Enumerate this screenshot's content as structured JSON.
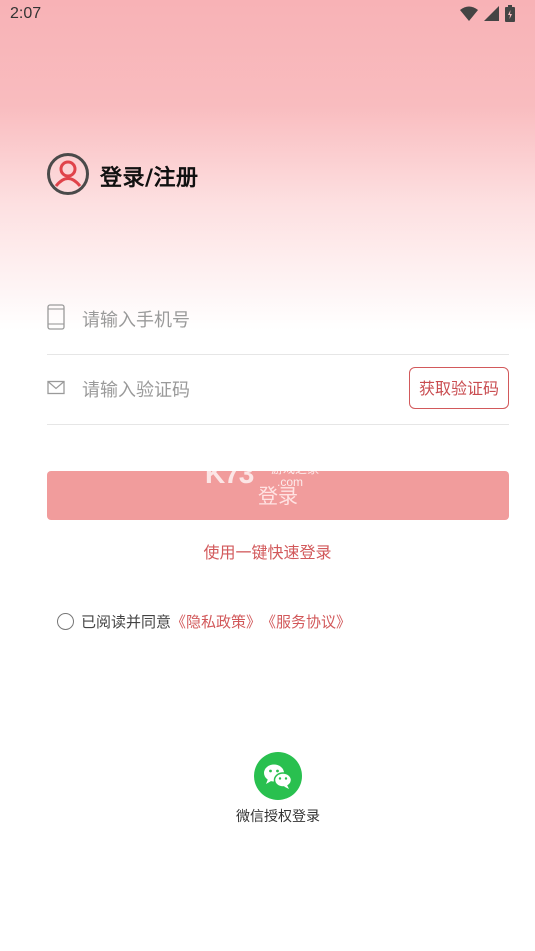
{
  "status_bar": {
    "time": "2:07",
    "icons": [
      "wifi-icon",
      "signal-icon",
      "battery-icon"
    ]
  },
  "header": {
    "title": "登录/注册",
    "icon": "user-avatar-icon"
  },
  "form": {
    "phone": {
      "placeholder": "请输入手机号",
      "value": "",
      "icon": "phone-icon"
    },
    "code": {
      "placeholder": "请输入验证码",
      "value": "",
      "icon": "mail-icon"
    },
    "get_code_label": "获取验证码",
    "login_label": "登录"
  },
  "watermark": {
    "main": "K73",
    "sub": "游戏之家",
    "domain": ".com"
  },
  "quick_login_label": "使用一键快速登录",
  "agreement": {
    "checked": false,
    "prefix": "已阅读并同意",
    "privacy_label": "《隐私政策》",
    "service_label": "《服务协议》"
  },
  "wechat": {
    "label": "微信授权登录",
    "icon": "wechat-icon"
  },
  "colors": {
    "accent": "#d2595b",
    "login_button": "#f19c9c",
    "wechat_green": "#29c04f",
    "hero_top": "#f8b2b6"
  }
}
